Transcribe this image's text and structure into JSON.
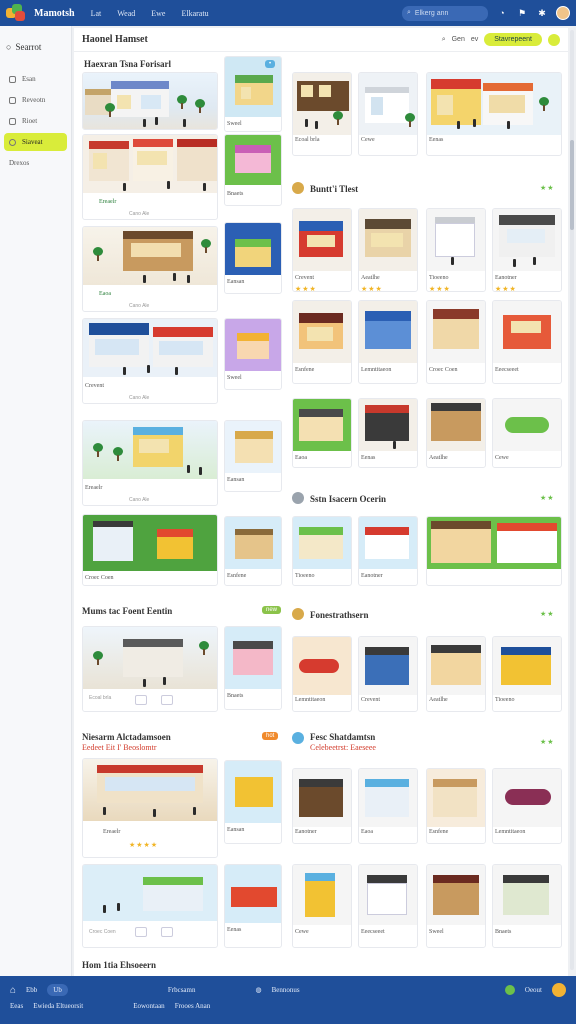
{
  "app": {
    "brand": "Mamotsh",
    "nav": [
      "Lat",
      "Wead",
      "Ewe",
      "Elkaratu"
    ]
  },
  "topbar": {
    "search_placeholder": "Elkerg ann",
    "icons": [
      "search-icon",
      "bell-icon",
      "flag-icon",
      "avatar"
    ]
  },
  "sidebar": {
    "search_label": "Searrot",
    "items": [
      {
        "label": "Esan",
        "active": false
      },
      {
        "label": "Reveotn",
        "active": false
      },
      {
        "label": "Rioet",
        "active": false
      },
      {
        "label": "Siaveat",
        "active": true
      },
      {
        "label": "Drexos",
        "active": false
      }
    ]
  },
  "main": {
    "title": "Haonel Hamset",
    "tools": {
      "search": "Gen",
      "zoom": "ev",
      "cta": "Stavrepeent"
    }
  },
  "sections": {
    "s1": {
      "title": "Haexran Tsna Forisarl"
    },
    "s2": {
      "title": "Buntt'i Tlest",
      "stars": "★★"
    },
    "s3": {
      "title": "Sstn Isacern Ocerin",
      "stars": "★★"
    },
    "s4": {
      "title": "Mums tac Foent Eentin",
      "badge": "new"
    },
    "s5": {
      "title": "Fonestrathsern",
      "stars": "★★"
    },
    "s6": {
      "title": "Niesarm Alctadamsoen",
      "subtitle": "Eedeet Eit I' Beoslomtr",
      "badge": "hot"
    },
    "s7": {
      "title": "Fesc Shatdamtsn",
      "subtitle": "Celebeetrst: Eaeseee",
      "stars": "★★"
    },
    "s8": {
      "title": "Hom 1tia Ehsoeern"
    }
  },
  "captions": {
    "c1": "Ecoal brla",
    "c2": "Sweel",
    "c3": "Eenas",
    "c4": "Cewe",
    "c5": "Ereaelr",
    "c6": "Cano Ale",
    "c7": "Bnaets",
    "c8": "Crevent",
    "c9": "Aeatlhe",
    "c10": "Tioeeno",
    "c11": "Eanotner",
    "c12": "Eaoa",
    "c13": "Eansan",
    "c14": "Esnfene",
    "c15": "Lemntitaeon",
    "c16": "Croec Coen",
    "c17": "Eeecseeet"
  },
  "bottombar": {
    "row1": [
      "Ebb",
      "Ub",
      "Frbcsamn",
      "Bennonus",
      "Oeout"
    ],
    "row2": [
      "Eeas",
      "Ewieda Eltueorsit",
      "Eowontaan",
      "Frooes Anan"
    ]
  }
}
